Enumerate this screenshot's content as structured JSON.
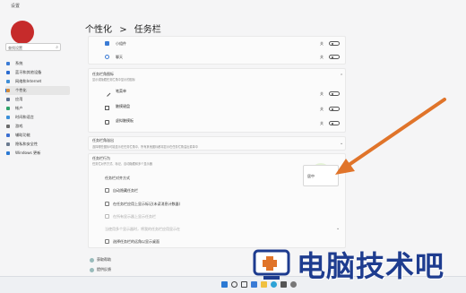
{
  "window": {
    "app_title": "设置"
  },
  "sidebar": {
    "search_placeholder": "查找设置",
    "items": [
      {
        "label": "系统",
        "icon": "monitor-icon",
        "color": "#3a7bd5"
      },
      {
        "label": "蓝牙和其他设备",
        "icon": "bluetooth-icon",
        "color": "#2b6cd1"
      },
      {
        "label": "网络和Internet",
        "icon": "network-icon",
        "color": "#3f8ed6"
      },
      {
        "label": "个性化",
        "icon": "brush-icon",
        "color": "#d08a3b"
      },
      {
        "label": "应用",
        "icon": "apps-icon",
        "color": "#5a6f8f"
      },
      {
        "label": "帐户",
        "icon": "account-icon",
        "color": "#2fa36b"
      },
      {
        "label": "时间和语言",
        "icon": "clock-icon",
        "color": "#3b8fd9"
      },
      {
        "label": "游戏",
        "icon": "gamepad-icon",
        "color": "#6b6b6b"
      },
      {
        "label": "辅助功能",
        "icon": "accessibility-icon",
        "color": "#3b6fd1"
      },
      {
        "label": "隐私和安全性",
        "icon": "shield-icon",
        "color": "#6b7a8f"
      },
      {
        "label": "Windows 更新",
        "icon": "update-icon",
        "color": "#2b79d3"
      }
    ],
    "active_index": 3
  },
  "header": {
    "parent": "个性化",
    "separator": ">",
    "current": "任务栏"
  },
  "taskbar_items": {
    "rows": [
      {
        "label": "小组件",
        "state": "关"
      },
      {
        "label": "聊天",
        "state": "关"
      }
    ]
  },
  "corner_icons": {
    "title": "任务栏角图标",
    "subtitle": "显示或隐藏任务栏角中显示的图标",
    "rows": [
      {
        "label": "笔菜单",
        "state": "关"
      },
      {
        "label": "触摸键盘",
        "state": "关"
      },
      {
        "label": "虚拟触摸板",
        "state": "关"
      }
    ]
  },
  "overflow": {
    "title": "任务栏角溢出",
    "subtitle": "选择哪些图标可能显示在任务栏角中，所有其他图标都将显示在任务栏角溢出菜单中"
  },
  "behaviors": {
    "title": "任务栏行为",
    "subtitle": "任务栏对齐方式、标记、自动隐藏和多个显示器",
    "align_label": "任务栏对齐方式",
    "button": "居中",
    "checkboxes": [
      "自动隐藏任务栏",
      "在任务栏应用上显示标记(未读消息计数器)",
      "在所有显示器上显示任务栏",
      "当使用多个显示器时，将我的任务栏应用显示在",
      "选择任务栏的远角以显示桌面"
    ]
  },
  "footer": {
    "links": [
      "获取帮助",
      "提供反馈"
    ]
  },
  "watermark": {
    "text": "电脑技术吧"
  },
  "colors": {
    "accent": "#1a73e8",
    "arrow": "#e0742a",
    "watermark": "#1e3c8f"
  }
}
